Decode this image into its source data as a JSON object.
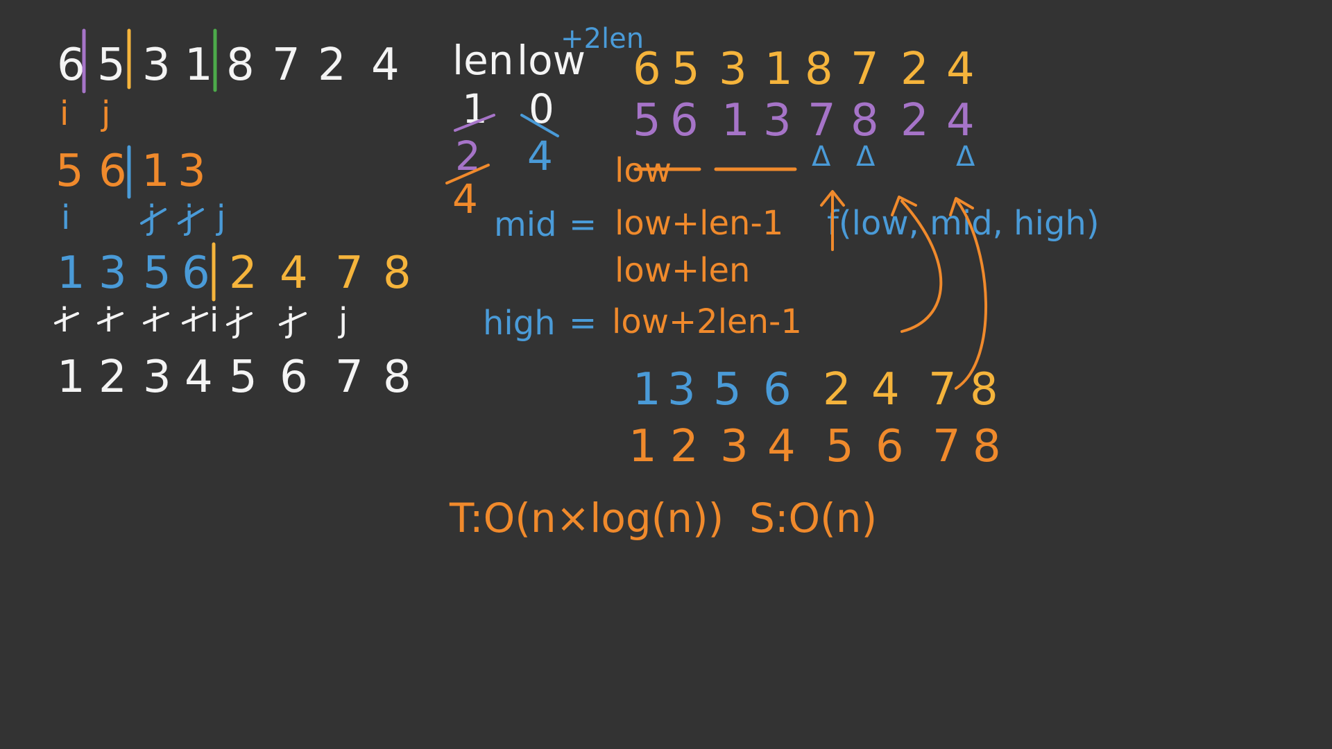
{
  "left": {
    "row1": [
      "6",
      "5",
      "3",
      "1",
      "8",
      "7",
      "2",
      "4"
    ],
    "row1_pointers": [
      "i",
      "j"
    ],
    "row2": [
      "5",
      "6",
      "1",
      "3"
    ],
    "row2_pointers": [
      "i",
      "j",
      "j",
      "j"
    ],
    "row3": [
      "1",
      "3",
      "5",
      "6",
      "2",
      "4",
      "7",
      "8"
    ],
    "row3_pointers": [
      "i",
      "i",
      "i",
      "i",
      "i",
      "j",
      "j",
      "j"
    ],
    "row4": [
      "1",
      "2",
      "3",
      "4",
      "5",
      "6",
      "7",
      "8"
    ]
  },
  "table": {
    "col_len": "len",
    "col_low": "low",
    "low_increment": "+2len",
    "len_values": [
      "1",
      "2",
      "4"
    ],
    "low_values": [
      "0",
      "4"
    ]
  },
  "right": {
    "row1": [
      "6",
      "5",
      "3",
      "1",
      "8",
      "7",
      "2",
      "4"
    ],
    "row2": [
      "5",
      "6",
      "1",
      "3",
      "7",
      "8",
      "2",
      "4"
    ],
    "triangle_marks": [
      "Δ",
      "Δ",
      "Δ"
    ],
    "low_label": "low",
    "mid_label": "mid",
    "mid_expr": "low+len-1",
    "low_len_expr": "low+len",
    "high_label": "high",
    "high_expr": "low+2len-1",
    "equals": "=",
    "func": "f(low, mid, high)",
    "row3": [
      "1",
      "3",
      "5",
      "6",
      "2",
      "4",
      "7",
      "8"
    ],
    "row4": [
      "1",
      "2",
      "3",
      "4",
      "5",
      "6",
      "7",
      "8"
    ],
    "complexity": "T:O(n×log(n))  S:O(n)"
  }
}
